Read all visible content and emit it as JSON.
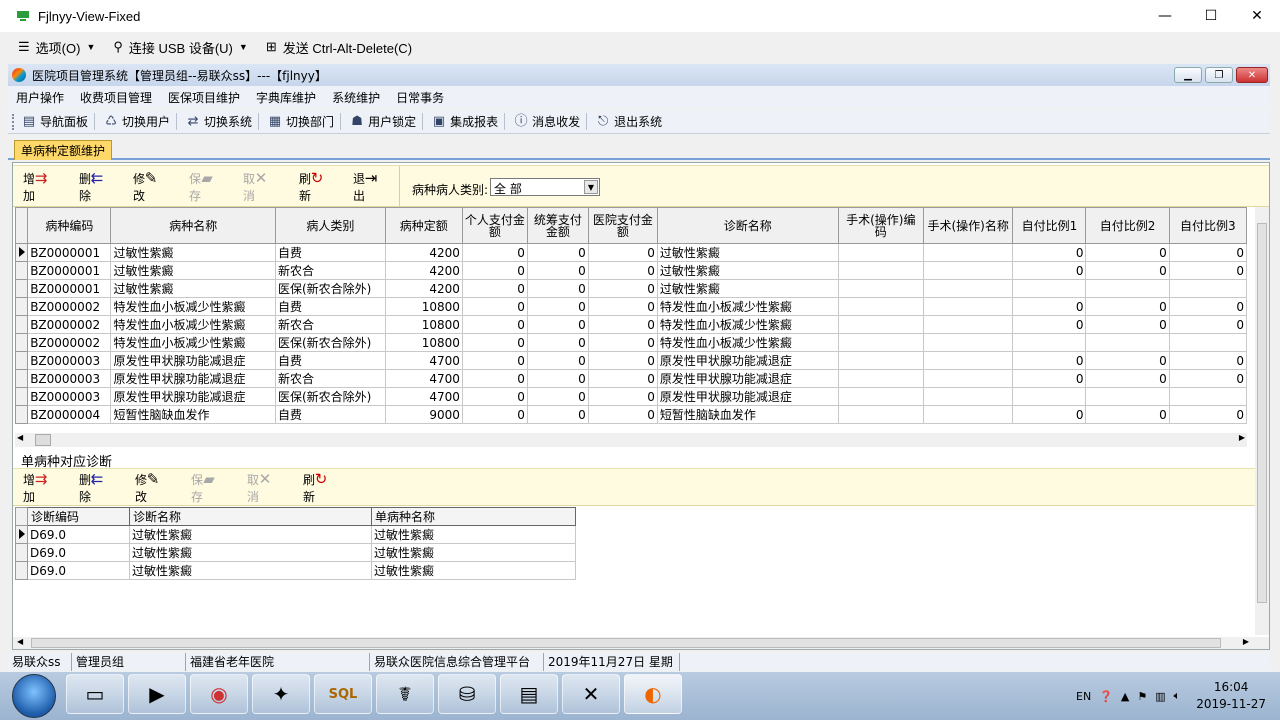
{
  "outer": {
    "title": "Fjlnyy-View-Fixed",
    "menu": [
      {
        "icon": "menu-icon",
        "label": "选项(O)"
      },
      {
        "icon": "usb-icon",
        "label": "连接 USB 设备(U)"
      },
      {
        "icon": "network-icon",
        "label": "发送 Ctrl-Alt-Delete(C)"
      }
    ]
  },
  "app": {
    "title": "医院项目管理系统【管理员组--易联众ss】---【fjlnyy】",
    "menu": [
      "用户操作",
      "收费项目管理",
      "医保项目维护",
      "字典库维护",
      "系统维护",
      "日常事务"
    ],
    "toolbar": [
      "导航面板",
      "切换用户",
      "切换系统",
      "切换部门",
      "用户锁定",
      "集成报表",
      "消息收发",
      "退出系统"
    ],
    "tab": "单病种定额维护"
  },
  "top_toolbar": {
    "buttons": [
      {
        "label": "增加",
        "icon": "add-icon",
        "enabled": true
      },
      {
        "label": "删除",
        "icon": "delete-icon",
        "enabled": true
      },
      {
        "label": "修改",
        "icon": "edit-icon",
        "enabled": true
      },
      {
        "label": "保存",
        "icon": "save-icon",
        "enabled": false
      },
      {
        "label": "取消",
        "icon": "cancel-icon",
        "enabled": false
      },
      {
        "label": "刷新",
        "icon": "refresh-icon",
        "enabled": true
      },
      {
        "label": "退出",
        "icon": "exit-icon",
        "enabled": true
      }
    ],
    "filter_label": "病种病人类别:",
    "filter_value": "全  部"
  },
  "main_table": {
    "headers": [
      "病种编码",
      "病种名称",
      "病人类别",
      "病种定额",
      "个人支付金额",
      "统筹支付金额",
      "医院支付金额",
      "诊断名称",
      "手术(操作)编码",
      "手术(操作)名称",
      "自付比例1",
      "自付比例2",
      "自付比例3"
    ],
    "rows": [
      [
        "BZ0000001",
        "过敏性紫癜",
        "自费",
        "4200",
        "0",
        "0",
        "0",
        "过敏性紫癜",
        "",
        "",
        "0",
        "0",
        "0"
      ],
      [
        "BZ0000001",
        "过敏性紫癜",
        "新农合",
        "4200",
        "0",
        "0",
        "0",
        "过敏性紫癜",
        "",
        "",
        "0",
        "0",
        "0"
      ],
      [
        "BZ0000001",
        "过敏性紫癜",
        "医保(新农合除外)",
        "4200",
        "0",
        "0",
        "0",
        "过敏性紫癜",
        "",
        "",
        "",
        "",
        ""
      ],
      [
        "BZ0000002",
        "特发性血小板减少性紫癜",
        "自费",
        "10800",
        "0",
        "0",
        "0",
        "特发性血小板减少性紫癜",
        "",
        "",
        "0",
        "0",
        "0"
      ],
      [
        "BZ0000002",
        "特发性血小板减少性紫癜",
        "新农合",
        "10800",
        "0",
        "0",
        "0",
        "特发性血小板减少性紫癜",
        "",
        "",
        "0",
        "0",
        "0"
      ],
      [
        "BZ0000002",
        "特发性血小板减少性紫癜",
        "医保(新农合除外)",
        "10800",
        "0",
        "0",
        "0",
        "特发性血小板减少性紫癜",
        "",
        "",
        "",
        "",
        ""
      ],
      [
        "BZ0000003",
        "原发性甲状腺功能减退症",
        "自费",
        "4700",
        "0",
        "0",
        "0",
        "原发性甲状腺功能减退症",
        "",
        "",
        "0",
        "0",
        "0"
      ],
      [
        "BZ0000003",
        "原发性甲状腺功能减退症",
        "新农合",
        "4700",
        "0",
        "0",
        "0",
        "原发性甲状腺功能减退症",
        "",
        "",
        "0",
        "0",
        "0"
      ],
      [
        "BZ0000003",
        "原发性甲状腺功能减退症",
        "医保(新农合除外)",
        "4700",
        "0",
        "0",
        "0",
        "原发性甲状腺功能减退症",
        "",
        "",
        "",
        "",
        ""
      ],
      [
        "BZ0000004",
        "短暂性脑缺血发作",
        "自费",
        "9000",
        "0",
        "0",
        "0",
        "短暂性脑缺血发作",
        "",
        "",
        "0",
        "0",
        "0"
      ]
    ]
  },
  "section2_title": "单病种对应诊断",
  "bottom_toolbar": {
    "buttons": [
      {
        "label": "增加",
        "icon": "add-icon",
        "enabled": true
      },
      {
        "label": "删除",
        "icon": "delete-icon",
        "enabled": true
      },
      {
        "label": "修改",
        "icon": "edit-icon",
        "enabled": true
      },
      {
        "label": "保存",
        "icon": "save-icon",
        "enabled": false
      },
      {
        "label": "取消",
        "icon": "cancel-icon",
        "enabled": false
      },
      {
        "label": "刷新",
        "icon": "refresh-icon",
        "enabled": true
      }
    ]
  },
  "diag_table": {
    "headers": [
      "诊断编码",
      "诊断名称",
      "单病种名称"
    ],
    "rows": [
      [
        "D69.0",
        "过敏性紫癜",
        "过敏性紫癜"
      ],
      [
        "D69.0",
        "过敏性紫癜",
        "过敏性紫癜"
      ],
      [
        "D69.0",
        "过敏性紫癜",
        "过敏性紫癜"
      ]
    ]
  },
  "status": [
    "易联众ss",
    "管理员组",
    "福建省老年医院",
    "易联众医院信息综合管理平台",
    "2019年11月27日 星期三"
  ],
  "tray": {
    "lang": "EN",
    "time": "16:04",
    "date": "2019-11-27"
  }
}
